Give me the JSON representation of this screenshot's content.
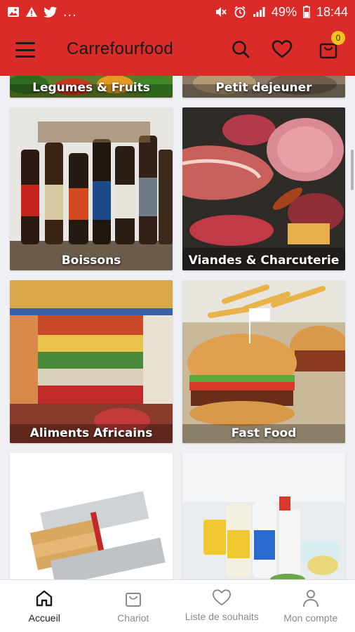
{
  "status_bar": {
    "battery": "49%",
    "time": "18:44",
    "overflow": "..."
  },
  "app_bar": {
    "title": "Carrefourfood",
    "cart_count": "0"
  },
  "categories": [
    {
      "label": "Legumes & Fruits"
    },
    {
      "label": "Petit dejeuner"
    },
    {
      "label": "Boissons"
    },
    {
      "label": "Viandes & Charcuterie"
    },
    {
      "label": "Aliments Africains"
    },
    {
      "label": "Fast Food"
    },
    {
      "label": ""
    },
    {
      "label": ""
    }
  ],
  "bottom_nav": [
    {
      "label": "Accueil",
      "icon": "home-icon",
      "active": true
    },
    {
      "label": "Chariot",
      "icon": "shopping-bag-icon"
    },
    {
      "label": "Liste de souhaits",
      "icon": "heart-icon"
    },
    {
      "label": "Mon compte",
      "icon": "person-icon"
    }
  ],
  "colors": {
    "brand": "#db2b28",
    "badge": "#f2c21d"
  }
}
